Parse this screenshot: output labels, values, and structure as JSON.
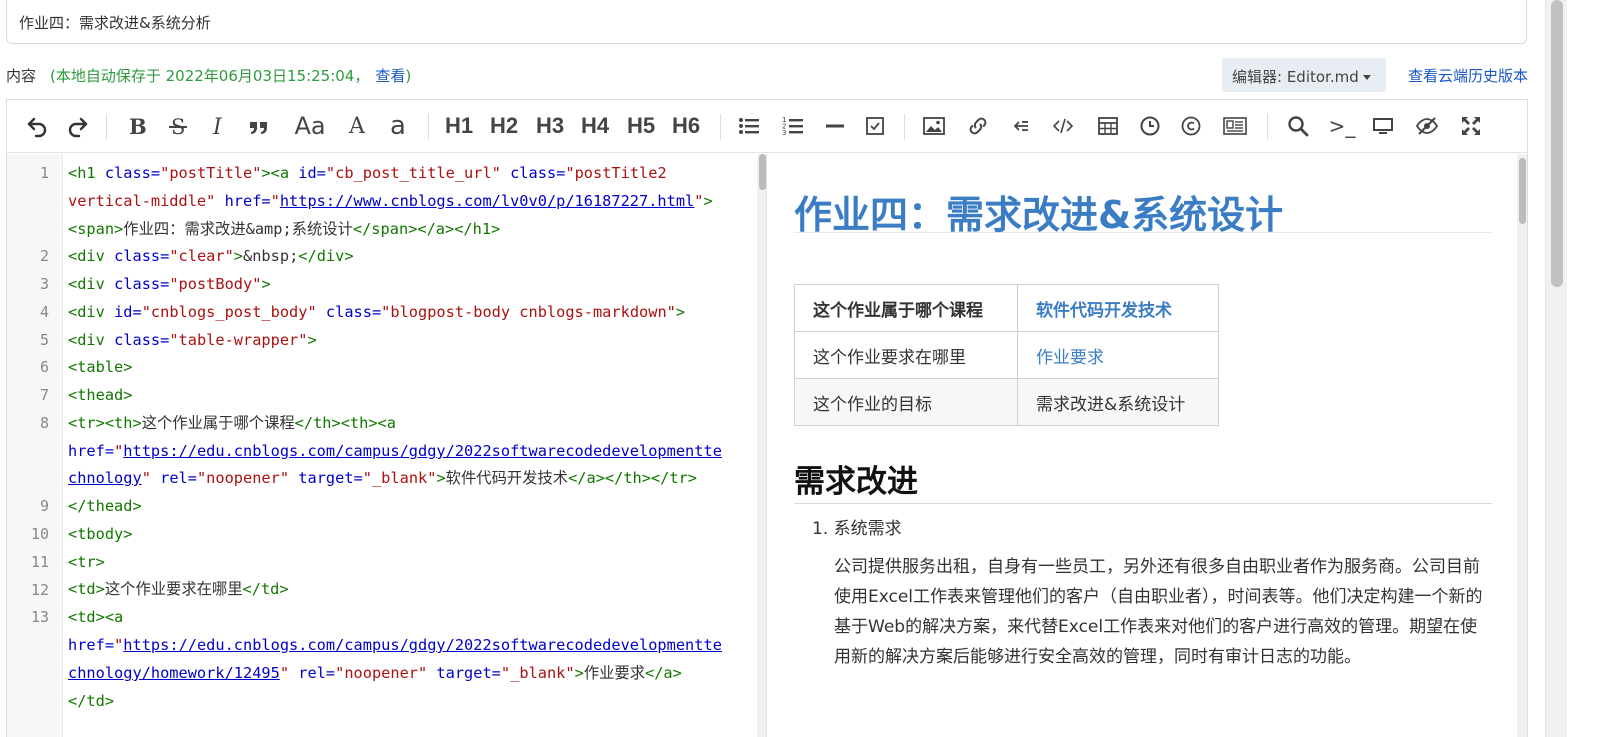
{
  "post": {
    "title_value": "作业四：需求改进&系统分析"
  },
  "content_bar": {
    "label": "内容",
    "autosave_text": "(本地自动保存于 2022年06月03日15:25:04，",
    "view_link": "查看",
    "autosave_close": ")",
    "editor_label": "编辑器: Editor.md",
    "history_link": "查看云端历史版本"
  },
  "toolbar": {
    "headings": [
      "H1",
      "H2",
      "H3",
      "H4",
      "H5",
      "H6"
    ],
    "font_big": "Aa",
    "font_a": "A",
    "font_small": "a",
    "terminal": ">_"
  },
  "code": {
    "line_numbers": [
      "1",
      "2",
      "3",
      "4",
      "5",
      "6",
      "7",
      "8",
      "9",
      "10",
      "11",
      "12",
      "13"
    ],
    "l1a_tag1": "<h1 ",
    "l1a_attr1": "class=",
    "l1a_str1": "\"postTitle\"",
    "l1a_tag2": "><a ",
    "l1a_attr2": "id=",
    "l1a_str2": "\"cb_post_title_url\"",
    "l1a_attr3": " class=",
    "l1a_str3": "\"postTitle2",
    "l1b_str": "vertical-middle\"",
    "l1b_attr": " href=",
    "l1b_q1": "\"",
    "l1b_url": "https://www.cnblogs.com/lv0v0/p/16187227.html",
    "l1b_q2": "\"",
    "l1b_tag": ">",
    "l1c_tag1": "<span>",
    "l1c_text": "作业四：需求改进&amp;系统设计",
    "l1c_tag2": "</span></a></h1>",
    "l2_tag1": "<div ",
    "l2_attr": "class=",
    "l2_str": "\"clear\"",
    "l2_tag2": ">",
    "l2_text": "&nbsp;",
    "l2_tag3": "</div>",
    "l3_tag1": "<div ",
    "l3_attr": "class=",
    "l3_str": "\"postBody\"",
    "l3_tag2": ">",
    "l4_tag1": "<div ",
    "l4_attr1": "id=",
    "l4_str1": "\"cnblogs_post_body\"",
    "l4_attr2": " class=",
    "l4_str2": "\"blogpost-body cnblogs-markdown\"",
    "l4_tag2": ">",
    "l5_tag1": "<div ",
    "l5_attr": "class=",
    "l5_str": "\"table-wrapper\"",
    "l5_tag2": ">",
    "l6": "<table>",
    "l7": "<thead>",
    "l8a_tag1": "<tr><th>",
    "l8a_text": "这个作业属于哪个课程",
    "l8a_tag2": "</th><th><a",
    "l8b_attr": "href=",
    "l8b_q1": "\"",
    "l8b_url": "https://edu.cnblogs.com/campus/gdgy/2022softwarecodedevelopmentte",
    "l8c_url": "chnology",
    "l8c_q2": "\"",
    "l8c_attr1": " rel=",
    "l8c_str1": "\"noopener\"",
    "l8c_attr2": " target=",
    "l8c_str2": "\"_blank\"",
    "l8c_tag1": ">",
    "l8c_text": "软件代码开发技术",
    "l8c_tag2": "</a></th></tr>",
    "l9": "</thead>",
    "l10": "<tbody>",
    "l11": "<tr>",
    "l12_tag1": "<td>",
    "l12_text": "这个作业要求在哪里",
    "l12_tag2": "</td>",
    "l13a": "<td><a",
    "l13b_attr": "href=",
    "l13b_q1": "\"",
    "l13b_url": "https://edu.cnblogs.com/campus/gdgy/2022softwarecodedevelopmentte",
    "l13c_url": "chnology/homework/12495",
    "l13c_q2": "\"",
    "l13c_attr1": " rel=",
    "l13c_str1": "\"noopener\"",
    "l13c_attr2": " target=",
    "l13c_str2": "\"_blank\"",
    "l13c_tag1": ">",
    "l13c_text": "作业要求",
    "l13c_tag2": "</a>",
    "l13d": "</td>"
  },
  "preview": {
    "title": "作业四：需求改进&系统设计",
    "table": {
      "rows": [
        {
          "k": "这个作业属于哪个课程",
          "v": "软件代码开发技术"
        },
        {
          "k": "这个作业要求在哪里",
          "v": "作业要求"
        },
        {
          "k": "这个作业的目标",
          "v": "需求改进&系统设计"
        }
      ]
    },
    "h2": "需求改进",
    "list_item": "1. 系统需求",
    "paragraph": "公司提供服务出租，自身有一些员工，另外还有很多自由职业者作为服务商。公司目前使用Excel工作表来管理他们的客户（自由职业者），时间表等。他们决定构建一个新的基于Web的解决方案，来代替Excel工作表来对他们的客户进行高效的管理。期望在使用新的解决方案后能够进行安全高效的管理，同时有审计日志的功能。"
  },
  "colors": {
    "accent_blue": "#3b7dc4",
    "link_blue": "#1a57c5",
    "autosave_green": "#2e9a3d",
    "code_tag_green": "#117700",
    "code_attr_blue": "#0000cc",
    "code_string_red": "#aa1111"
  }
}
